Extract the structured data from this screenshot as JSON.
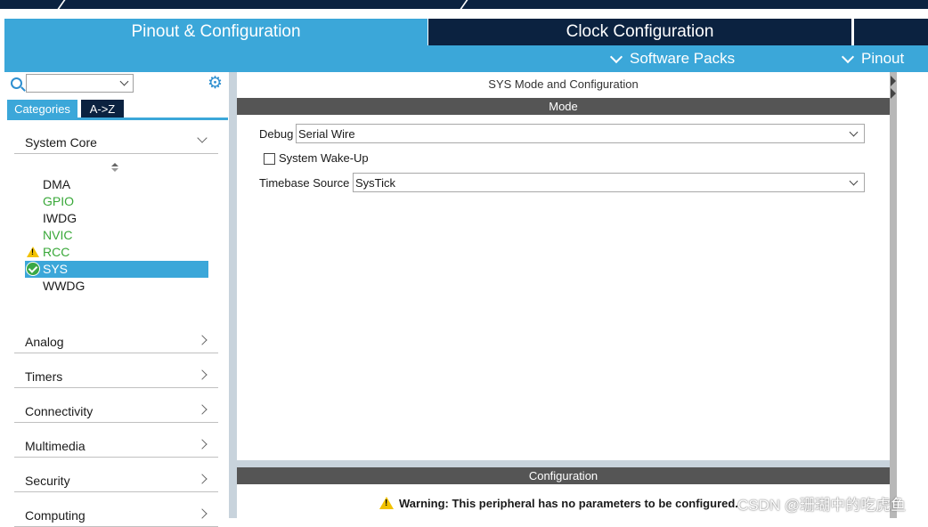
{
  "top_tabs": {
    "active_label": "Pinout & Configuration",
    "clock_label": "Clock Configuration"
  },
  "secondary_menu": {
    "software_packs": "Software Packs",
    "pinout": "Pinout"
  },
  "left_panel": {
    "search_value": "",
    "tabs": {
      "categories": "Categories",
      "az": "A->Z"
    },
    "system_core": {
      "label": "System Core",
      "items": [
        {
          "label": "DMA",
          "state": "normal"
        },
        {
          "label": "GPIO",
          "state": "green"
        },
        {
          "label": "IWDG",
          "state": "normal"
        },
        {
          "label": "NVIC",
          "state": "green"
        },
        {
          "label": "RCC",
          "state": "warning"
        },
        {
          "label": "SYS",
          "state": "selected-ok"
        },
        {
          "label": "WWDG",
          "state": "normal"
        }
      ]
    },
    "categories": [
      "Analog",
      "Timers",
      "Connectivity",
      "Multimedia",
      "Security",
      "Computing"
    ]
  },
  "main_panel": {
    "title": "SYS Mode and Configuration",
    "mode_header": "Mode",
    "debug_label": "Debug",
    "debug_value": "Serial Wire",
    "wakeup_label": "System Wake-Up",
    "wakeup_checked": false,
    "timebase_label": "Timebase Source",
    "timebase_value": "SysTick",
    "config_header": "Configuration",
    "warning_text": "Warning: This peripheral has no parameters to be configured."
  },
  "watermark": "CSDN @珊瑚中的吃虎鱼",
  "colors": {
    "accent_blue": "#3ba7d9",
    "dark_navy": "#0b2240",
    "section_gray": "#555555",
    "ok_green": "#3aa846",
    "warning_yellow": "#f2c200",
    "text_green": "#39a839"
  }
}
